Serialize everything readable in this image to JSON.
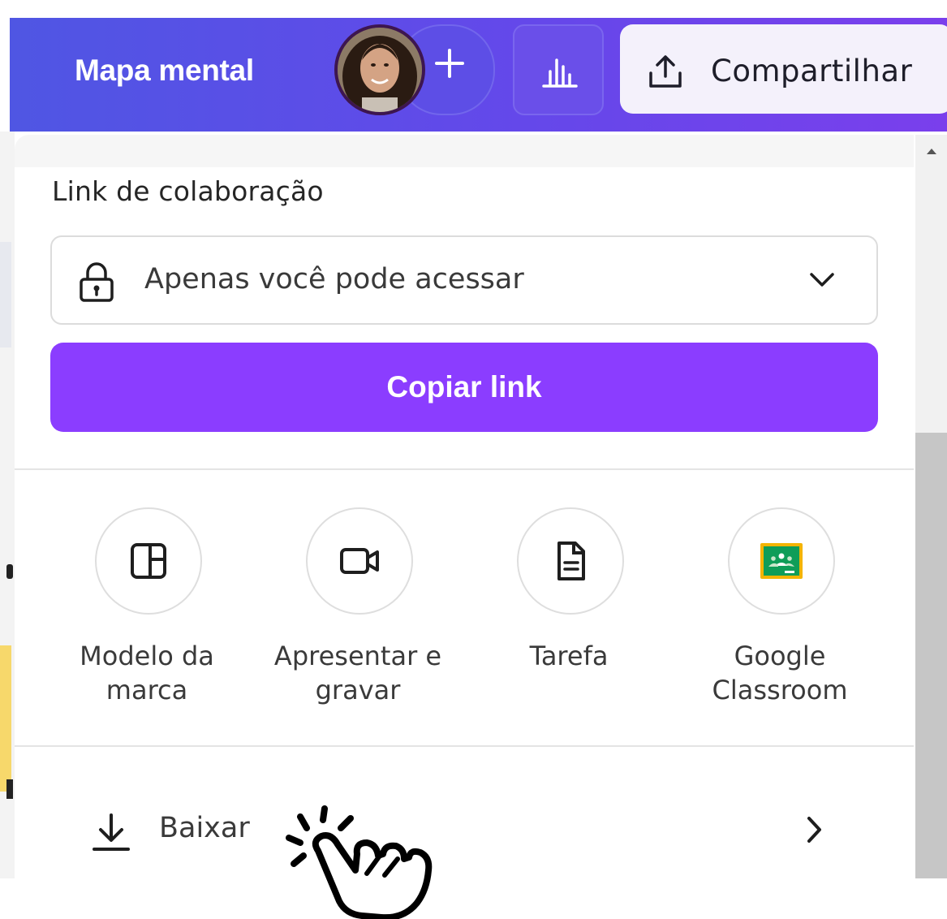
{
  "header": {
    "doc_title": "Mapa mental",
    "share_label": "Compartilhar",
    "gradient_from": "#4f56e3",
    "gradient_to": "#7a3fec"
  },
  "panel": {
    "link_section_title": "Link de colaboração",
    "access_value": "Apenas você pode acessar",
    "copy_button_label": "Copiar link",
    "accent_color": "#8b3dff",
    "share_options": [
      {
        "label": "Modelo da marca",
        "icon": "brand-template-icon"
      },
      {
        "label": "Apresentar e gravar",
        "icon": "video-camera-icon"
      },
      {
        "label": "Tarefa",
        "icon": "document-icon"
      },
      {
        "label": "Google Classroom",
        "icon": "google-classroom-icon"
      }
    ],
    "download_label": "Baixar"
  }
}
